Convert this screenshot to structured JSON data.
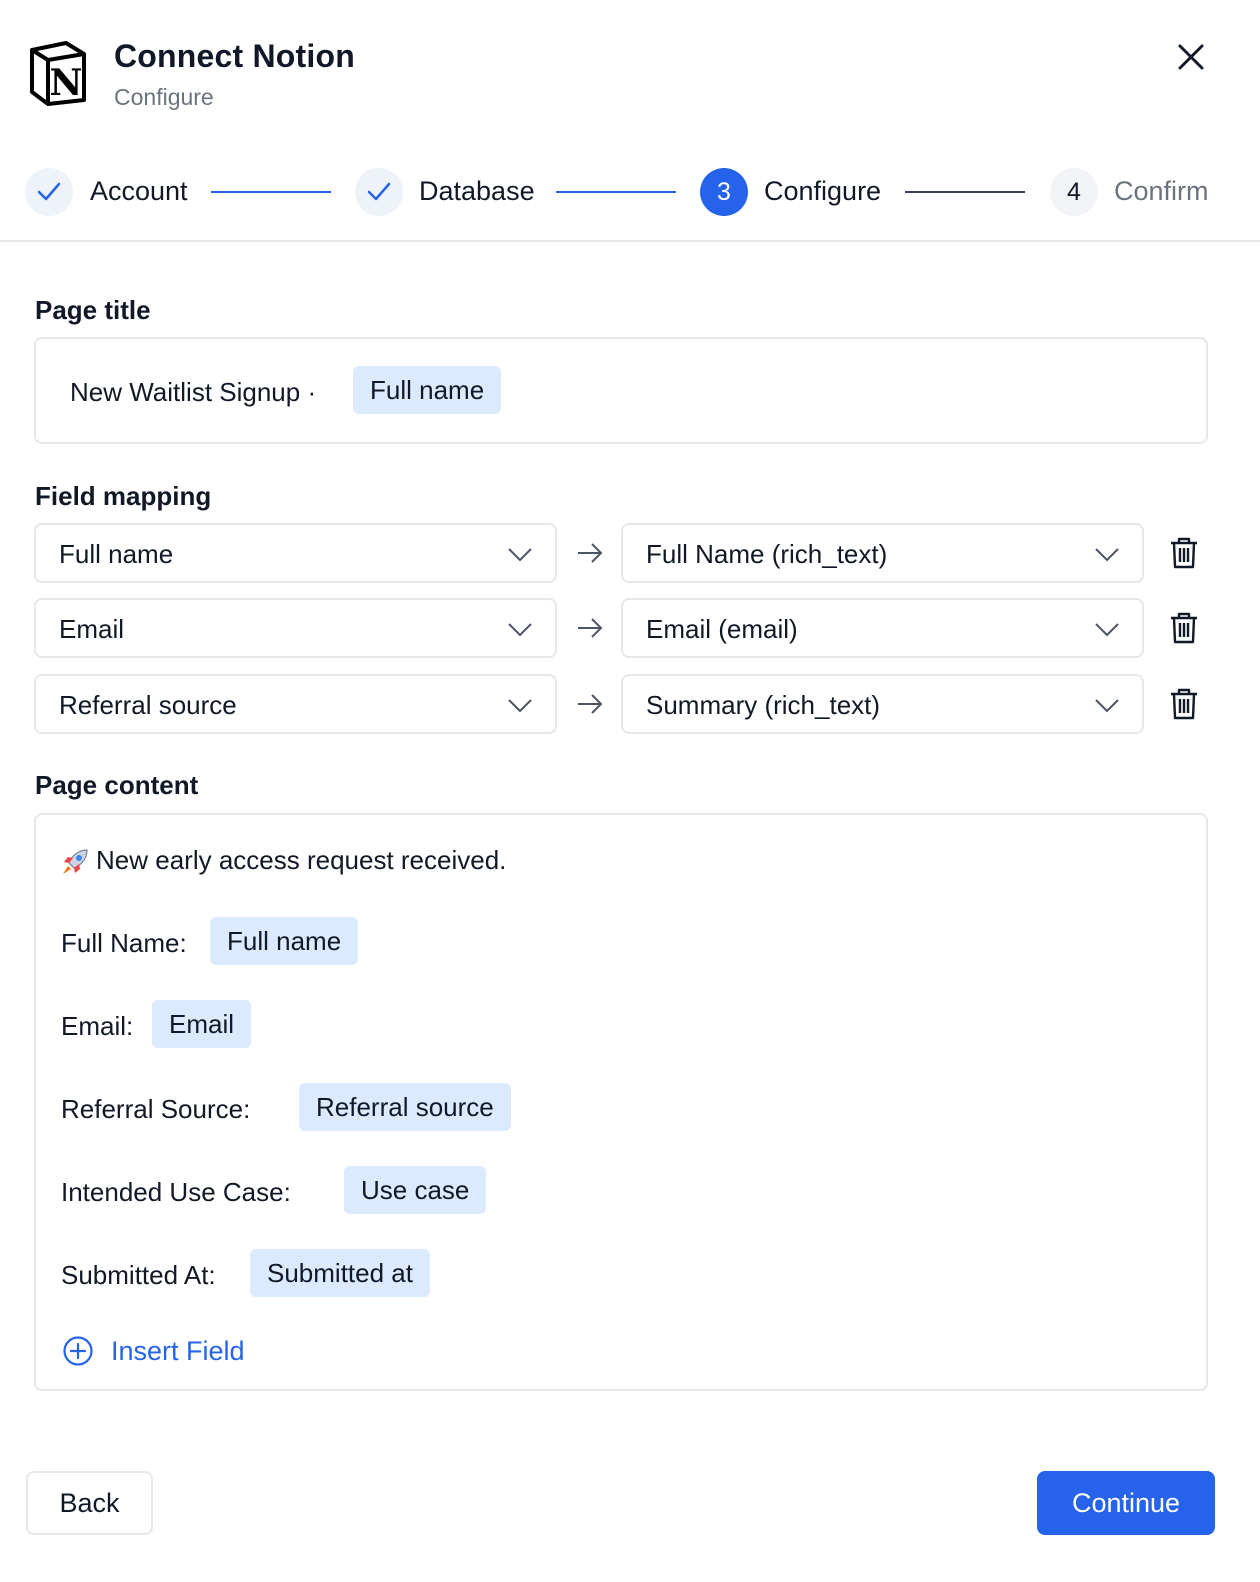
{
  "header": {
    "title": "Connect Notion",
    "subtitle": "Configure",
    "logo_letter": "N"
  },
  "stepper": {
    "steps": [
      {
        "label": "Account",
        "state": "done"
      },
      {
        "label": "Database",
        "state": "done"
      },
      {
        "number": "3",
        "label": "Configure",
        "state": "active"
      },
      {
        "number": "4",
        "label": "Confirm",
        "state": "todo"
      }
    ]
  },
  "page_title": {
    "label": "Page title",
    "text": "New Waitlist Signup ·",
    "chip": "Full name"
  },
  "field_mapping": {
    "label": "Field mapping",
    "rows": [
      {
        "source": "Full name",
        "target": "Full Name (rich_text)"
      },
      {
        "source": "Email",
        "target": "Email (email)"
      },
      {
        "source": "Referral source",
        "target": "Summary (rich_text)"
      }
    ]
  },
  "page_content": {
    "label": "Page content",
    "intro": "New early access request received.",
    "lines": [
      {
        "label": "Full Name:",
        "chip": "Full name"
      },
      {
        "label": "Email:",
        "chip": "Email"
      },
      {
        "label": "Referral Source:",
        "chip": "Referral source"
      },
      {
        "label": "Intended Use Case:",
        "chip": "Use case"
      },
      {
        "label": "Submitted At:",
        "chip": "Submitted at"
      }
    ],
    "insert_label": "Insert Field"
  },
  "footer": {
    "back_label": "Back",
    "continue_label": "Continue"
  },
  "colors": {
    "accent": "#2563eb",
    "chip_bg": "#dbeafe",
    "border": "#e5e7eb",
    "muted_text": "#6b7280"
  }
}
